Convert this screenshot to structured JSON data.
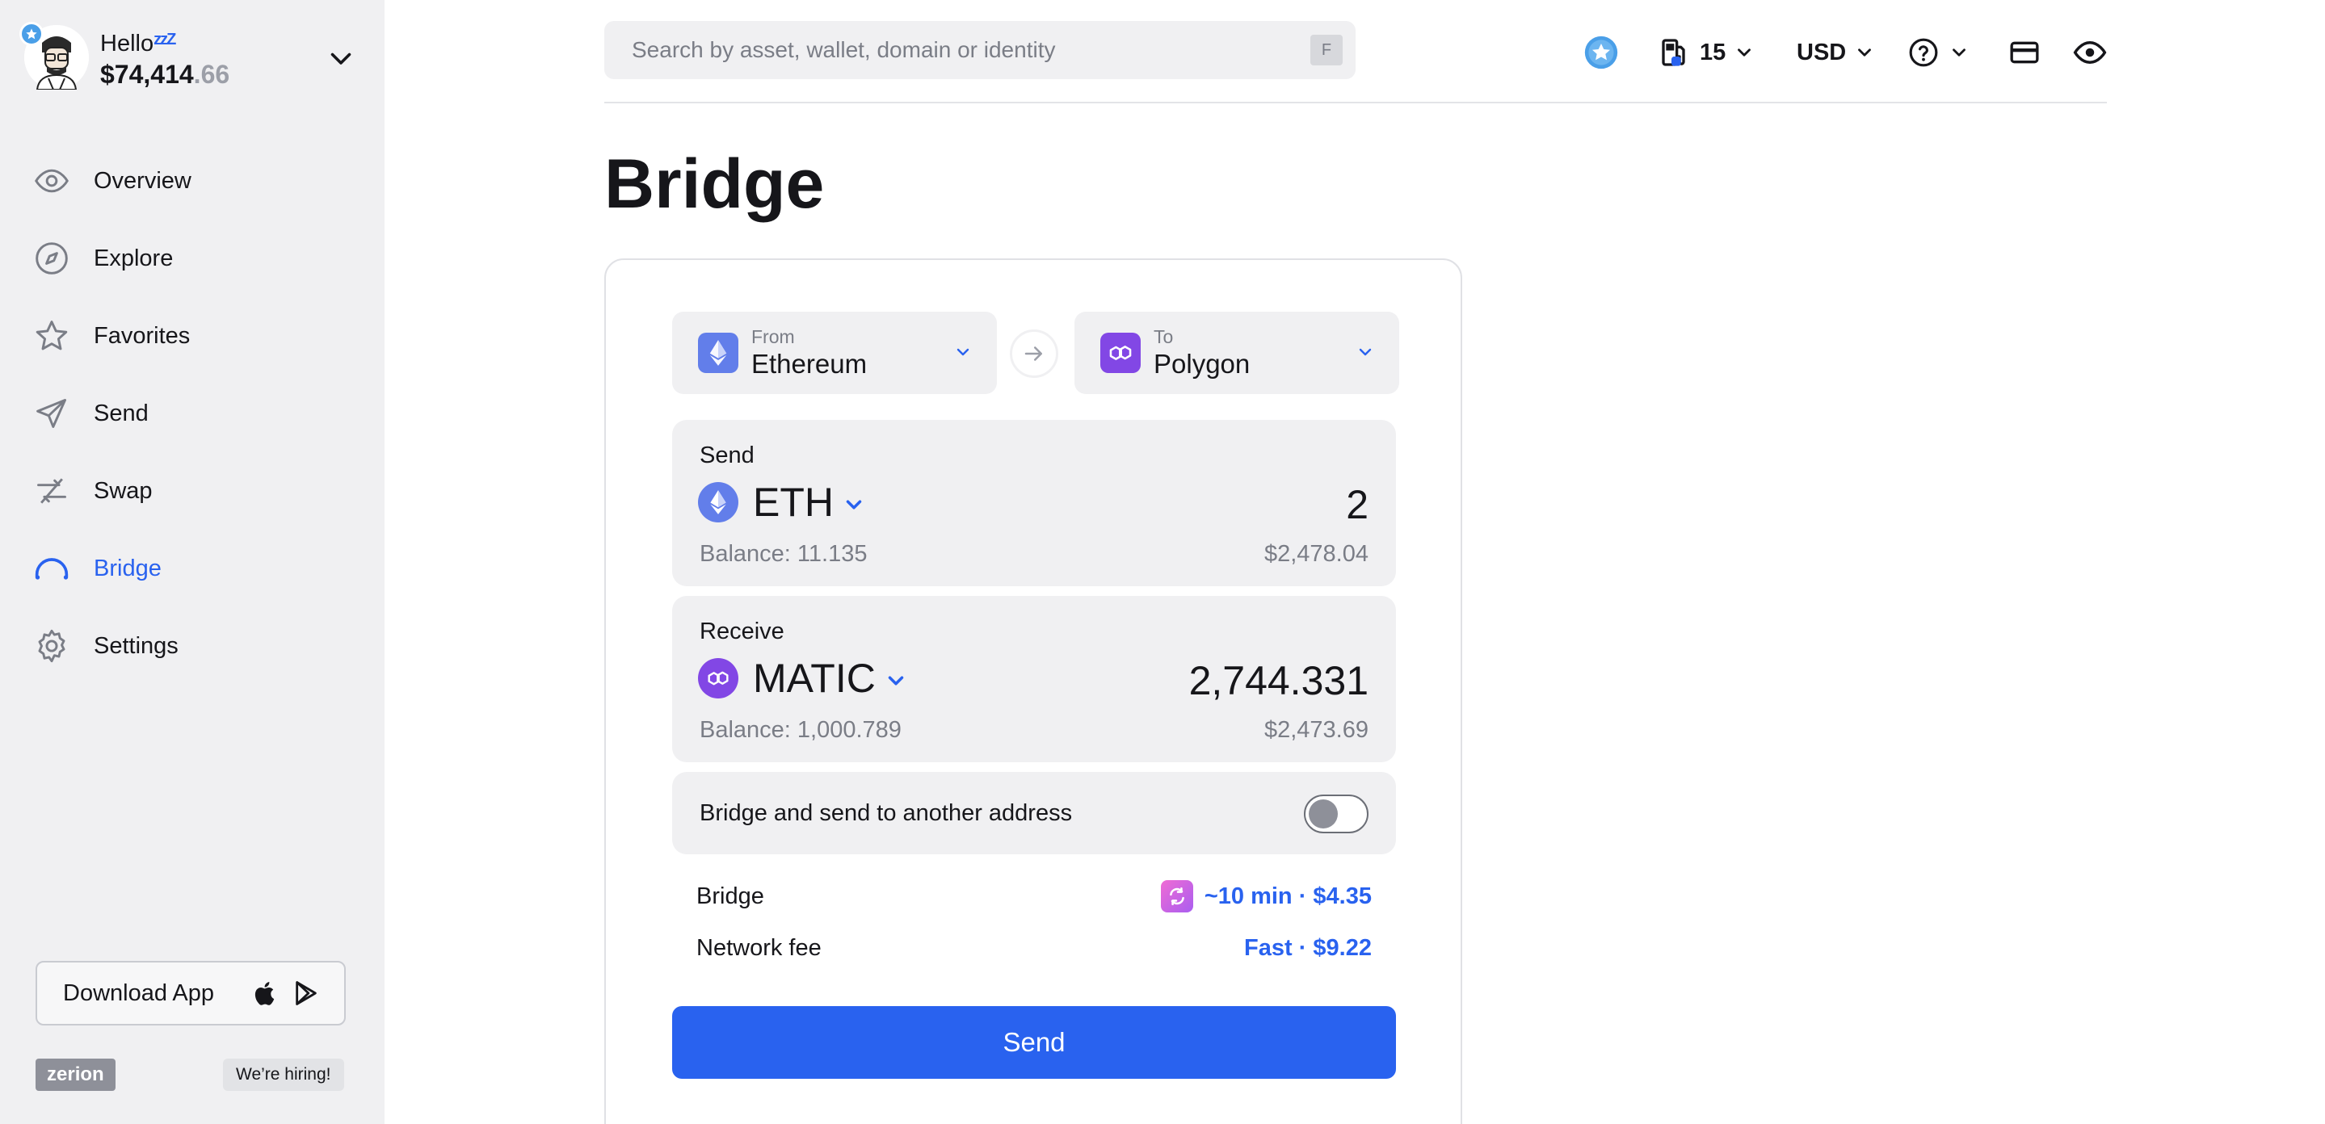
{
  "profile": {
    "greeting": "Hello",
    "status_glyph": "zzZ",
    "balance_main": "$74,414",
    "balance_cents": ".66"
  },
  "nav": [
    {
      "label": "Overview",
      "icon": "eye-icon"
    },
    {
      "label": "Explore",
      "icon": "compass-icon"
    },
    {
      "label": "Favorites",
      "icon": "star-icon"
    },
    {
      "label": "Send",
      "icon": "send-icon"
    },
    {
      "label": "Swap",
      "icon": "swap-icon"
    },
    {
      "label": "Bridge",
      "icon": "bridge-icon",
      "active": true
    },
    {
      "label": "Settings",
      "icon": "gear-icon"
    }
  ],
  "sidebar_footer": {
    "download_label": "Download App",
    "logo_text": "zerion",
    "hiring_label": "We’re hiring!"
  },
  "search": {
    "placeholder": "Search by asset, wallet, domain or identity",
    "shortcut": "F"
  },
  "topbar": {
    "gas_value": "15",
    "currency": "USD"
  },
  "page": {
    "title": "Bridge"
  },
  "bridge": {
    "from": {
      "label": "From",
      "chain": "Ethereum"
    },
    "to": {
      "label": "To",
      "chain": "Polygon"
    },
    "send": {
      "label": "Send",
      "token": "ETH",
      "amount": "2",
      "balance": "Balance: 11.135",
      "usd": "$2,478.04"
    },
    "receive": {
      "label": "Receive",
      "token": "MATIC",
      "amount": "2,744.331",
      "balance": "Balance: 1,000.789",
      "usd": "$2,473.69"
    },
    "toggle_label": "Bridge and send to another address",
    "toggle_on": false,
    "route": {
      "label": "Bridge",
      "value": "~10 min · $4.35"
    },
    "fee": {
      "label": "Network fee",
      "value": "Fast · $9.22"
    },
    "submit_label": "Send"
  },
  "colors": {
    "accent": "#2962ef",
    "sidebar_bg": "#f0f0f2",
    "ethereum": "#627eea",
    "polygon": "#8247e5"
  }
}
